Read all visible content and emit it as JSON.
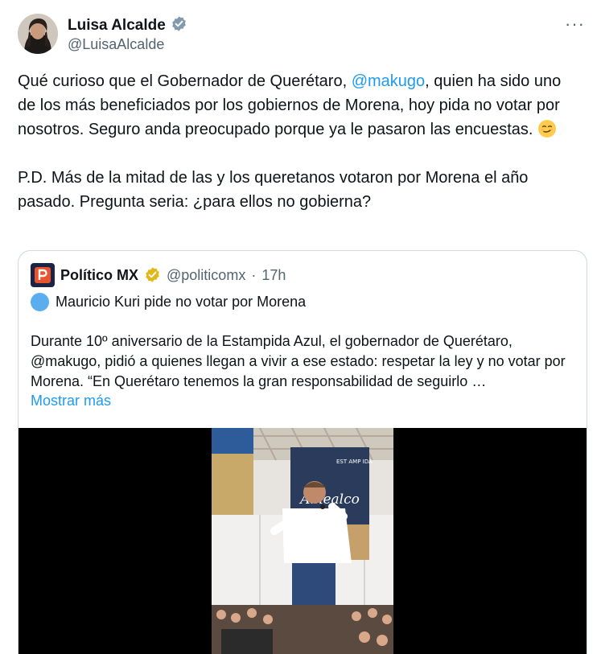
{
  "author": {
    "name": "Luisa Alcalde",
    "handle": "@LuisaAlcalde"
  },
  "more_menu": "···",
  "tweet": {
    "p1_a": "Qué curioso que el Gobernador de Querétaro, ",
    "p1_mention": "@makugo",
    "p1_b": ", quien ha sido uno de los más beneficiados por los gobiernos de Morena, hoy pida no votar por nosotros. Seguro anda preocupado porque ya le pasaron las encuestas. ",
    "p2": "P.D. Más de la mitad de las y los queretanos votaron por Morena el año pasado. Pregunta seria: ¿para ellos no gobierna?"
  },
  "quote": {
    "name": "Político MX",
    "handle": "@politicomx",
    "separator": "·",
    "time": "17h",
    "headline": "Mauricio Kuri pide no votar por Morena",
    "body": "Durante 10º aniversario de la Estampida Azul, el gobernador de Querétaro, @makugo, pidió a quienes llegan a vivir a ese estado: respetar la ley y no votar por Morena. “En Querétaro tenemos la gran responsabilidad de seguirlo …",
    "show_more": "Mostrar más",
    "banner_text": "Amealco",
    "banner_small": "EST AMP IDA"
  },
  "colors": {
    "link": "#1d9bf0",
    "muted": "#536471",
    "verified_grey": "#829aab",
    "verified_gold": "#e2b719"
  },
  "icons": [
    "verified-grey-badge-icon",
    "more-icon",
    "smirk-emoji-icon",
    "politico-logo-icon",
    "verified-gold-badge-icon",
    "blue-circle-emoji"
  ]
}
